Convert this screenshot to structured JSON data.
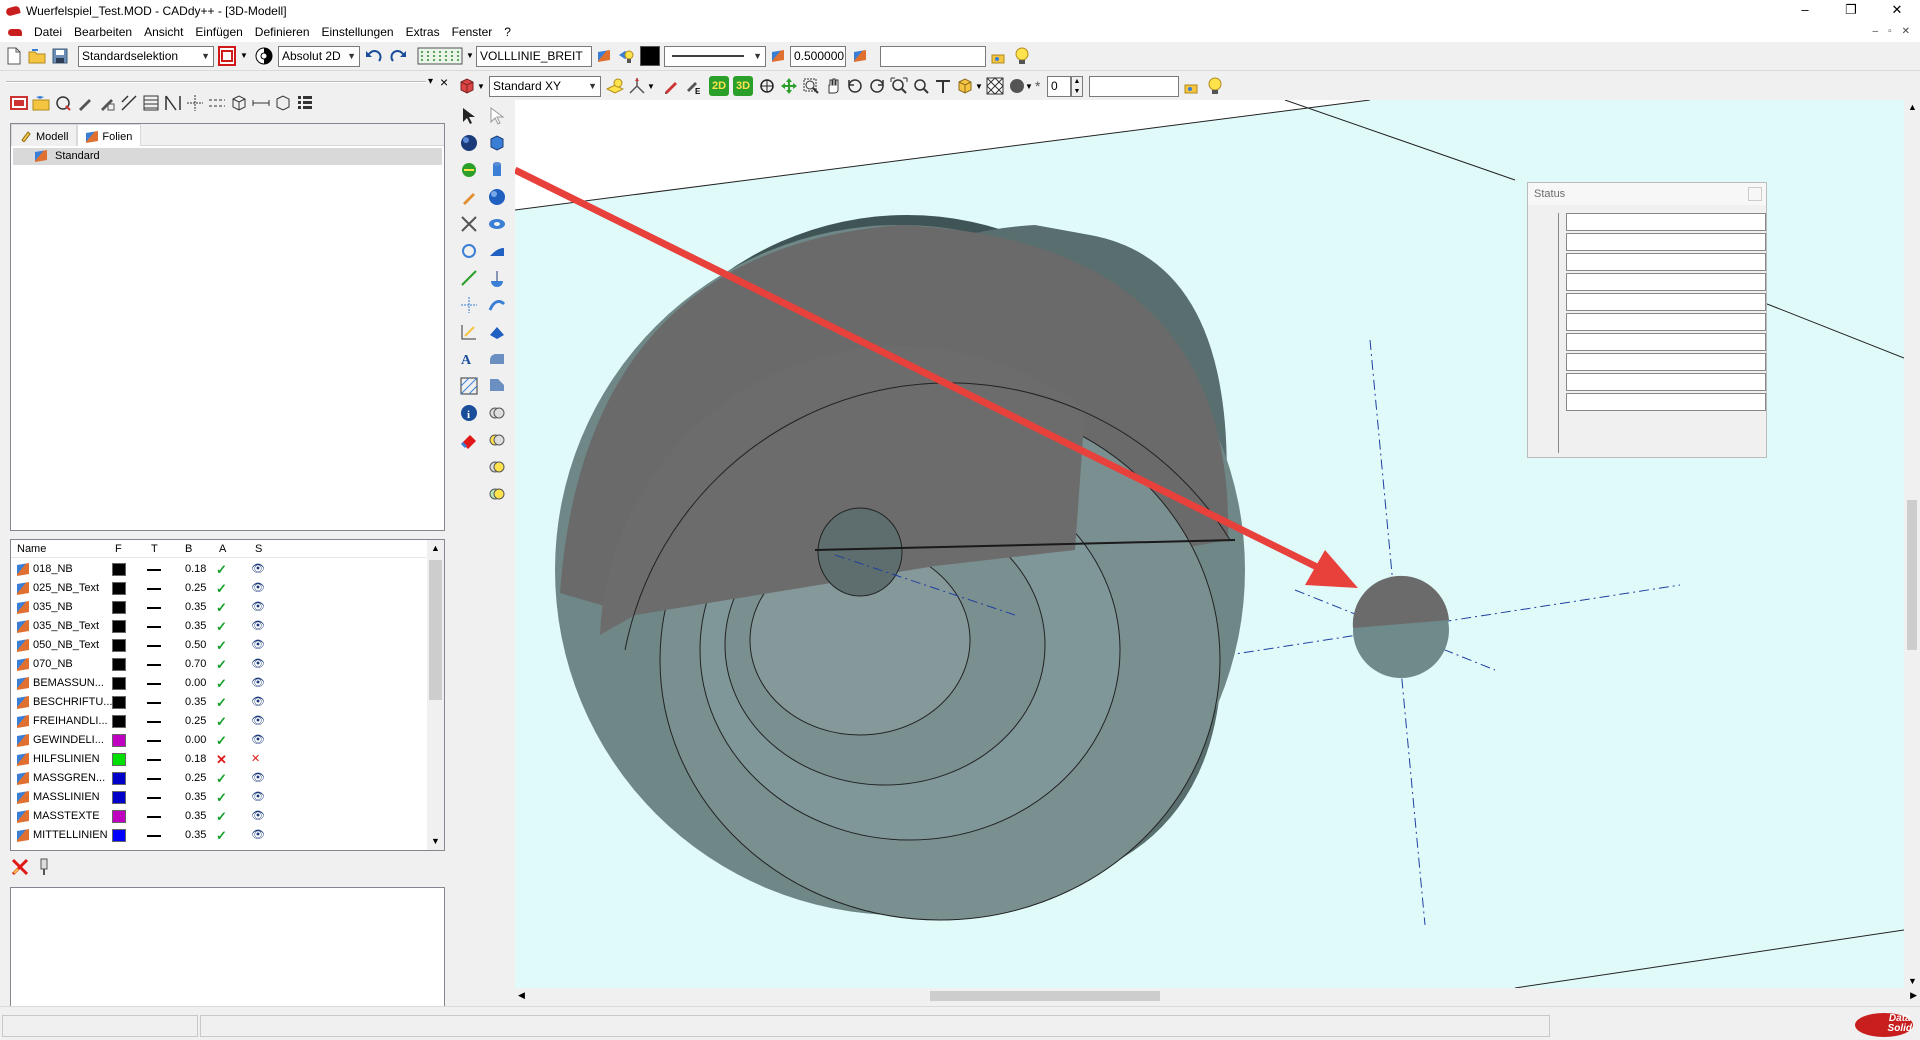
{
  "window": {
    "title": "Wuerfelspiel_Test.MOD  -  CADdy++ - [3D-Modell]",
    "controls": [
      "–",
      "❐",
      "✕"
    ]
  },
  "menubar": {
    "items": [
      "Datei",
      "Bearbeiten",
      "Ansicht",
      "Einfügen",
      "Definieren",
      "Einstellungen",
      "Extras",
      "Fenster",
      "?"
    ],
    "mdi_controls": [
      "–",
      "▫",
      "✕"
    ]
  },
  "toolbar1": {
    "selection_mode": "Standardselektion",
    "coord_mode": "Absolut 2D",
    "line_type": "VOLLLINIE_BREIT",
    "line_width": "0.500000",
    "text_field": ""
  },
  "toolbar2": {
    "view_plane": "Standard XY",
    "btn_2d": "2D",
    "btn_3d": "3D",
    "star": "*",
    "layer_value": "0",
    "text_field": ""
  },
  "left_panel": {
    "pin": "▾",
    "close": "×",
    "tabs": [
      {
        "label": "Modell",
        "icon": "model-icon"
      },
      {
        "label": "Folien",
        "icon": "layers-icon"
      }
    ],
    "tree_selected": "Standard",
    "list_headers": {
      "name": "Name",
      "f": "F",
      "t": "T",
      "b": "B",
      "a": "A",
      "s": "S"
    },
    "layers": [
      {
        "name": "018_NB",
        "color": "#000000",
        "width": "0.18",
        "active": "✓",
        "visible": "👁"
      },
      {
        "name": "025_NB_Text",
        "color": "#000000",
        "width": "0.25",
        "active": "✓",
        "visible": "👁"
      },
      {
        "name": "035_NB",
        "color": "#000000",
        "width": "0.35",
        "active": "✓",
        "visible": "👁"
      },
      {
        "name": "035_NB_Text",
        "color": "#000000",
        "width": "0.35",
        "active": "✓",
        "visible": "👁"
      },
      {
        "name": "050_NB_Text",
        "color": "#000000",
        "width": "0.50",
        "active": "✓",
        "visible": "👁"
      },
      {
        "name": "070_NB",
        "color": "#000000",
        "width": "0.70",
        "active": "✓",
        "visible": "👁"
      },
      {
        "name": "BEMASSUN...",
        "color": "#000000",
        "width": "0.00",
        "active": "✓",
        "visible": "👁"
      },
      {
        "name": "BESCHRIFTU...",
        "color": "#000000",
        "width": "0.35",
        "active": "✓",
        "visible": "👁"
      },
      {
        "name": "FREIHANDLI...",
        "color": "#000000",
        "width": "0.25",
        "active": "✓",
        "visible": "👁"
      },
      {
        "name": "GEWINDELI...",
        "color": "#c000c0",
        "width": "0.00",
        "active": "✓",
        "visible": "👁"
      },
      {
        "name": "HILFSLINIEN",
        "color": "#00e000",
        "width": "0.18",
        "active": "✕",
        "visible": "✕"
      },
      {
        "name": "MASSGREN...",
        "color": "#0000c8",
        "width": "0.25",
        "active": "✓",
        "visible": "👁"
      },
      {
        "name": "MASSLINIEN",
        "color": "#0000c8",
        "width": "0.35",
        "active": "✓",
        "visible": "👁"
      },
      {
        "name": "MASSTEXTE",
        "color": "#c000c0",
        "width": "0.35",
        "active": "✓",
        "visible": "👁"
      },
      {
        "name": "MITTELLINIEN",
        "color": "#0000ff",
        "width": "0.35",
        "active": "✓",
        "visible": "👁"
      }
    ],
    "colors": {
      "check": "#16a02a",
      "cross": "#e01818",
      "eye": "#1a3a7a"
    }
  },
  "status_window": {
    "title": "Status"
  },
  "viewport": {
    "annotation_color": "#e8413c",
    "background": "#e0fafa"
  }
}
